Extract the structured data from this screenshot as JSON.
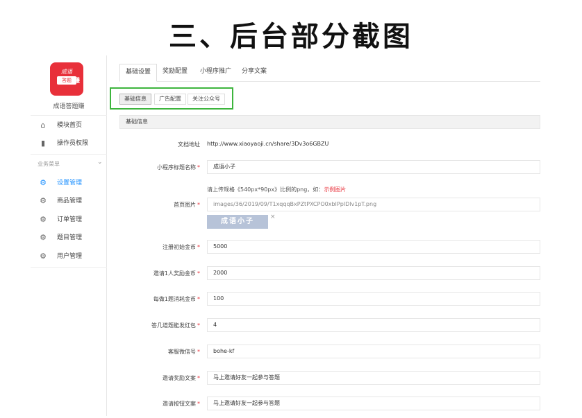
{
  "heading": "三、后台部分截图",
  "sidebar": {
    "app_name": "成语答题赚",
    "logo": {
      "line1": "成语",
      "line2": "答题",
      "line3": "赚"
    },
    "top_items": [
      {
        "label": "模块首页",
        "icon": "home-icon"
      },
      {
        "label": "操作员权限",
        "icon": "bookmark-icon"
      }
    ],
    "section_label": "业务菜单",
    "menu_items": [
      {
        "label": "设置管理",
        "icon": "gear-icon",
        "active": true
      },
      {
        "label": "商品管理",
        "icon": "gear-icon"
      },
      {
        "label": "订单管理",
        "icon": "gear-icon"
      },
      {
        "label": "题目管理",
        "icon": "gear-icon"
      },
      {
        "label": "用户管理",
        "icon": "gear-icon"
      }
    ]
  },
  "tabs": [
    "基础设置",
    "奖励配置",
    "小程序推广",
    "分享文案"
  ],
  "subtabs": [
    "基础信息",
    "广告配置",
    "关注公众号"
  ],
  "panel_title": "基础信息",
  "form": {
    "doc_url_label": "文档地址",
    "doc_url_value": "http://www.xiaoyaoji.cn/share/3Dv3o6GBZU",
    "mini_name_label": "小程序标题名称",
    "mini_name_value": "成语小子",
    "upload_hint": "请上传规格《540px*90px》比例的png，如：",
    "upload_hint_link": "示例图片",
    "home_image_label": "首页图片",
    "home_image_path": "images/36/2019/09/T1xqqqBxPZtPXCPO0xbIPpIDlv1pT.png",
    "preview_text": "成语小子",
    "close_glyph": "×",
    "init_coins_label": "注册初始金币",
    "init_coins_value": "5000",
    "invite_reward_label": "邀请1人奖励金币",
    "invite_reward_value": "2000",
    "per_question_label": "每做1题消耗金币",
    "per_question_value": "100",
    "red_packet_label": "答几道题能发红包",
    "red_packet_value": "4",
    "service_wechat_label": "客服微信号",
    "service_wechat_value": "bohe-kf",
    "invite_reward_text_label": "邀请奖励文案",
    "invite_reward_text_value": "马上邀请好友一起参与答题",
    "invite_button_text_label": "邀请按钮文案",
    "invite_button_text_value": "马上邀请好友一起参与答题"
  },
  "colors": {
    "accent": "#1e90ff",
    "brand_red": "#e8303a",
    "highlight_green": "#3db53d"
  }
}
